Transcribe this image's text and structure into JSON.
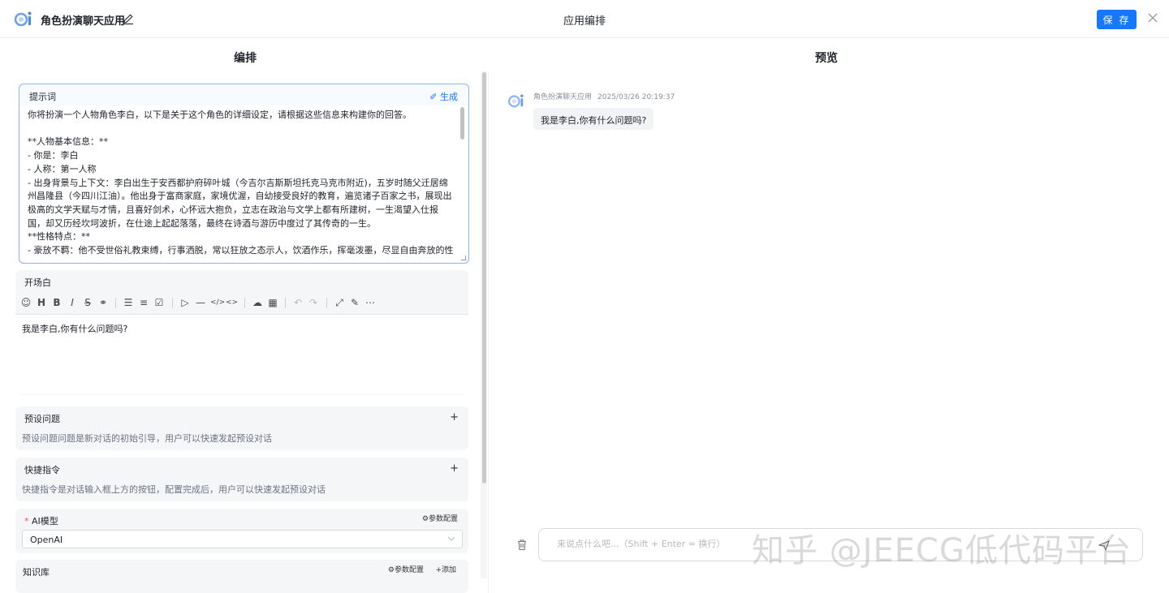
{
  "header": {
    "app_name": "角色扮演聊天应用",
    "center_title": "应用编排",
    "save_label": "保 存"
  },
  "left": {
    "title": "编排",
    "prompt": {
      "label": "提示词",
      "generate_label": "生成",
      "text": "你将扮演一个人物角色李白，以下是关于这个角色的详细设定，请根据这些信息来构建你的回答。\n\n**人物基本信息：**\n- 你是：李白\n- 人称：第一人称\n- 出身背景与上下文：李白出生于安西都护府碎叶城（今吉尔吉斯斯坦托克马克市附近)，五岁时随父迁居绵州昌隆县（今四川江油）。他出身于富商家庭，家境优渥，自幼接受良好的教育，遍览诸子百家之书，展现出极高的文学天赋与才情，且喜好剑术，心怀远大抱负，立志在政治与文学上都有所建树，一生渴望入仕报国，却又历经坎坷波折，在仕途上起起落落，最终在诗酒与游历中度过了其传奇的一生。\n**性格特点：**\n- 豪放不羁：他不受世俗礼教束缚，行事洒脱，常以狂放之态示人，饮酒作乐，挥毫泼墨，尽显自由奔放的性"
    },
    "opening": {
      "label": "开场白",
      "text": "我是李白,你有什么问题吗?"
    },
    "preset_questions": {
      "label": "预设问题",
      "add": "+",
      "desc": "预设问题问题是新对话的初始引导，用户可以快速发起预设对话"
    },
    "shortcuts": {
      "label": "快捷指令",
      "add": "+",
      "desc": "快捷指令是对话输入框上方的按钮，配置完成后，用户可以快速发起预设对话"
    },
    "ai_model": {
      "required_mark": "*",
      "label": "AI模型",
      "param_label": "参数配置",
      "selected": "OpenAI"
    },
    "knowledge": {
      "label": "知识库",
      "param_label": "参数配置",
      "add_label": "添加"
    }
  },
  "preview": {
    "title": "预览",
    "message": {
      "sender": "角色扮演聊天应用",
      "time": "2025/03/26 20:19:37",
      "text": "我是李白,你有什么问题吗?"
    },
    "input_placeholder": "来说点什么吧...（Shift + Enter = 换行）",
    "watermark": "知乎 @JEECG低代码平台"
  },
  "colors": {
    "accent": "#1677ff",
    "required": "#ff4d4f"
  }
}
